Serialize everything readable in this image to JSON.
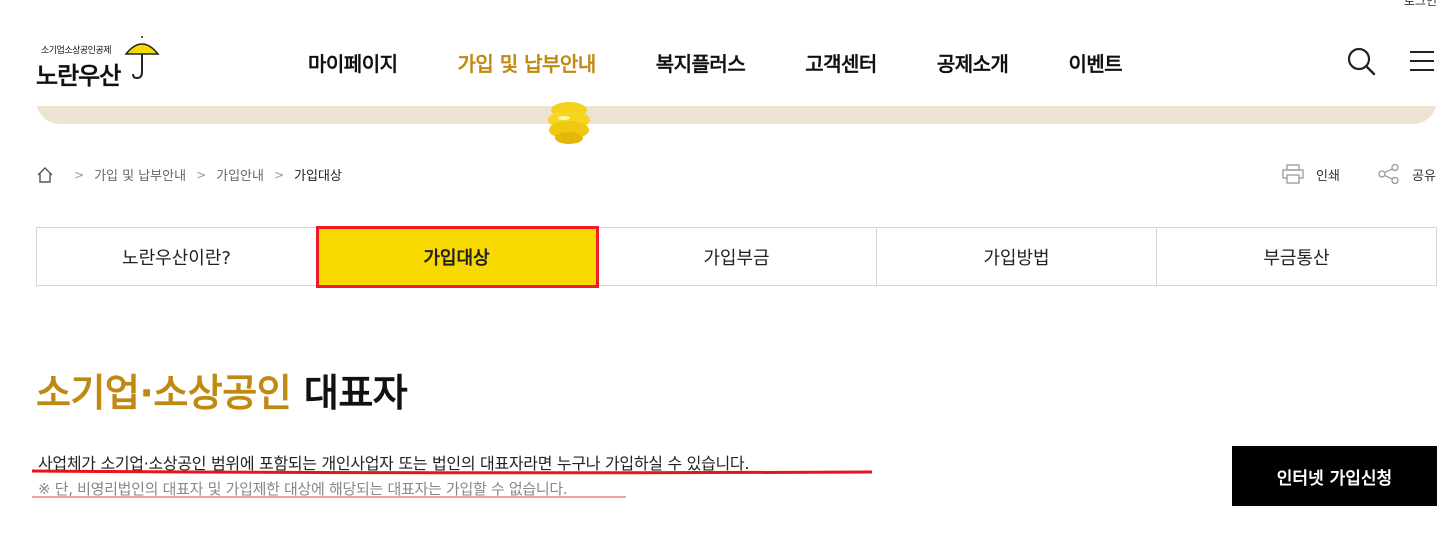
{
  "header": {
    "top_link": "로그인",
    "logo_sub": "소기업소상공인공제",
    "logo_main": "노란우산",
    "nav": [
      {
        "label": "마이페이지",
        "active": false
      },
      {
        "label": "가입 및 납부안내",
        "active": true
      },
      {
        "label": "복지플러스",
        "active": false
      },
      {
        "label": "고객센터",
        "active": false
      },
      {
        "label": "공제소개",
        "active": false
      },
      {
        "label": "이벤트",
        "active": false
      }
    ],
    "icons": [
      "search-icon",
      "hamburger-menu-icon"
    ]
  },
  "breadcrumb": [
    "가입 및 납부안내",
    "가입안내",
    "가입대상"
  ],
  "utilities": {
    "print": "인쇄",
    "share": "공유"
  },
  "tabs": [
    {
      "label": "노란우산이란?",
      "active": false
    },
    {
      "label": "가입대상",
      "active": true
    },
    {
      "label": "가입부금",
      "active": false
    },
    {
      "label": "가입방법",
      "active": false
    },
    {
      "label": "부금통산",
      "active": false
    }
  ],
  "content": {
    "title_accent": "소기업·소상공인",
    "title_plain": " 대표자",
    "description": "사업체가 소기업·소상공인 범위에 포함되는 개인사업자 또는 법인의 대표자라면 누구나 가입하실 수 있습니다.",
    "note": "※ 단, 비영리법인의 대표자 및 가입제한 대상에 해당되는 대표자는 가입할 수 없습니다.",
    "apply_button": "인터넷 가입신청"
  },
  "colors": {
    "brand_yellow": "#f8d900",
    "accent_gold": "#c08a12",
    "highlight_red": "#ee1c25",
    "banner_beige": "#ece3d3"
  }
}
